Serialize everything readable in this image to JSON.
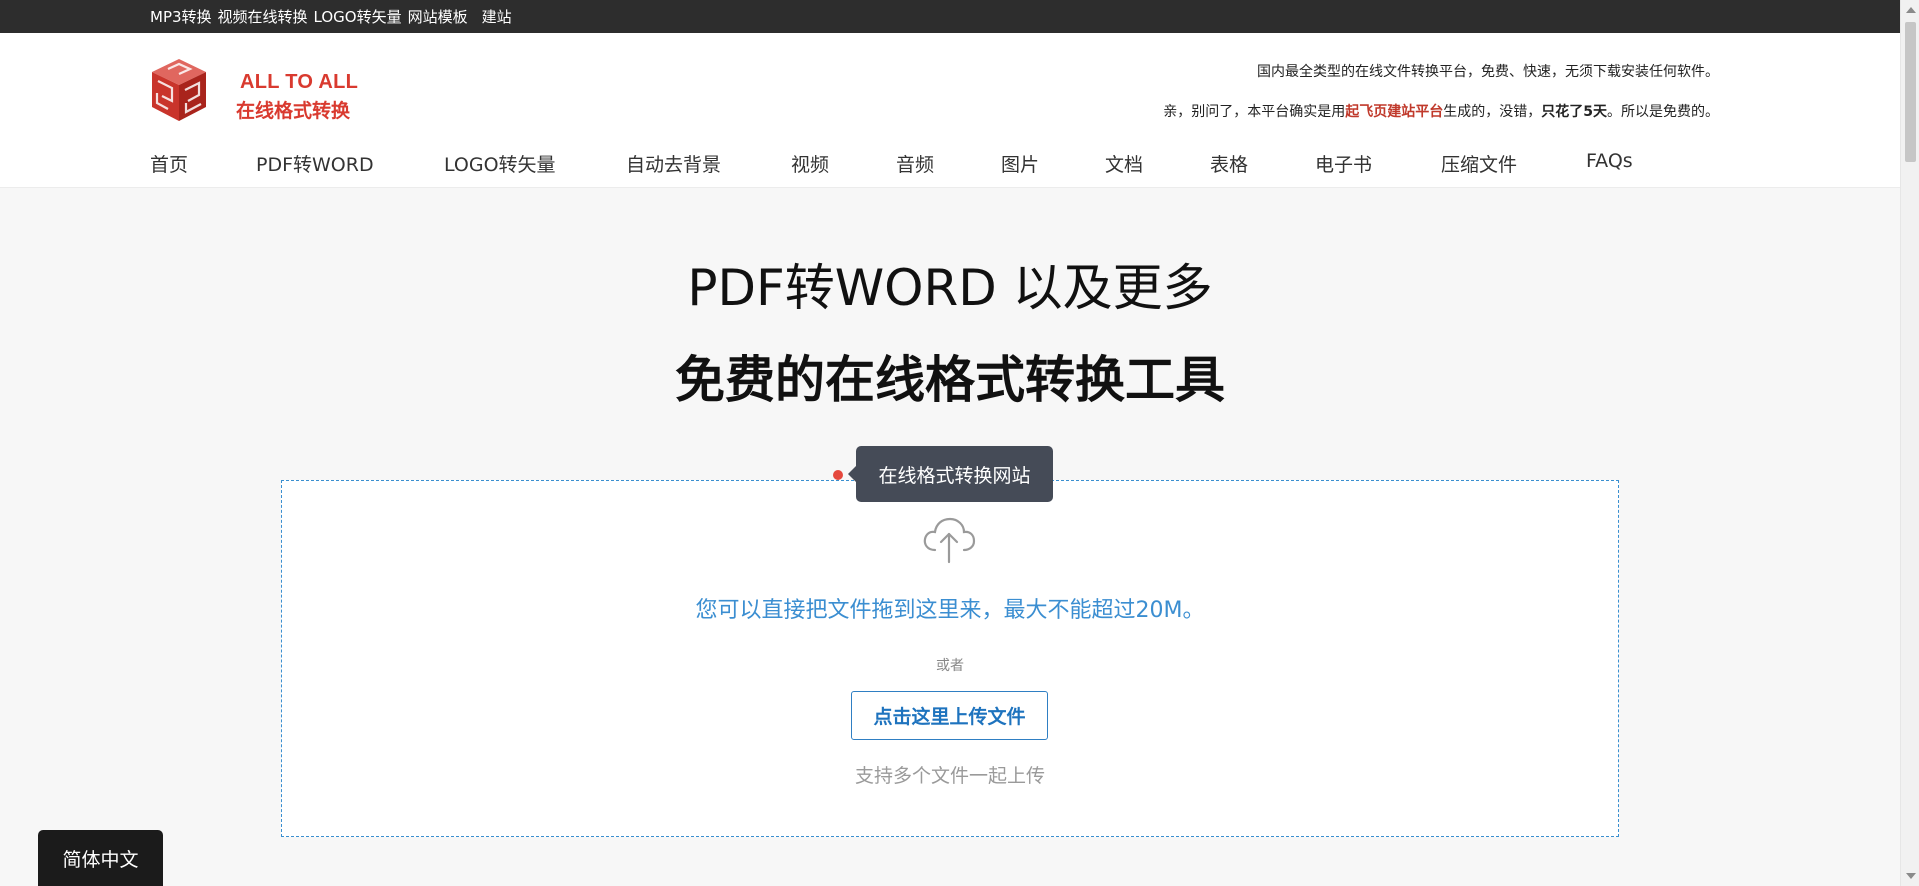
{
  "topbar": {
    "links": [
      "MP3转换",
      "视频在线转换",
      "LOGO转矢量",
      "网站模板",
      "建站"
    ]
  },
  "brand": {
    "line1": "ALL TO ALL",
    "line2": "在线格式转换",
    "color": "#d93a2f"
  },
  "taglines": {
    "line1": "国内最全类型的在线文件转换平台，免费、快速，无须下载安装任何软件。",
    "line2_prefix": "亲，别问了，本平台确实是用",
    "line2_highlight": "起飞页建站平台",
    "line2_mid": "生成的，没错，",
    "line2_bold": "只花了5天",
    "line2_suffix": "。所以是免费的。"
  },
  "nav": {
    "items": [
      "首页",
      "PDF转WORD",
      "LOGO转矢量",
      "自动去背景",
      "视频",
      "音频",
      "图片",
      "文档",
      "表格",
      "电子书",
      "压缩文件",
      "FAQs"
    ]
  },
  "hero": {
    "line1": "PDF转WORD 以及更多",
    "line2": "免费的在线格式转换工具"
  },
  "dropzone": {
    "tooltip": "在线格式转换网站",
    "icon": "cloud-upload-icon",
    "drop_text": "您可以直接把文件拖到这里来，最大不能超过20M。",
    "or_text": "或者",
    "upload_button": "点击这里上传文件",
    "multi_text": "支持多个文件一起上传",
    "accent_color": "#3b8ed1"
  },
  "language": {
    "label": "简体中文"
  }
}
